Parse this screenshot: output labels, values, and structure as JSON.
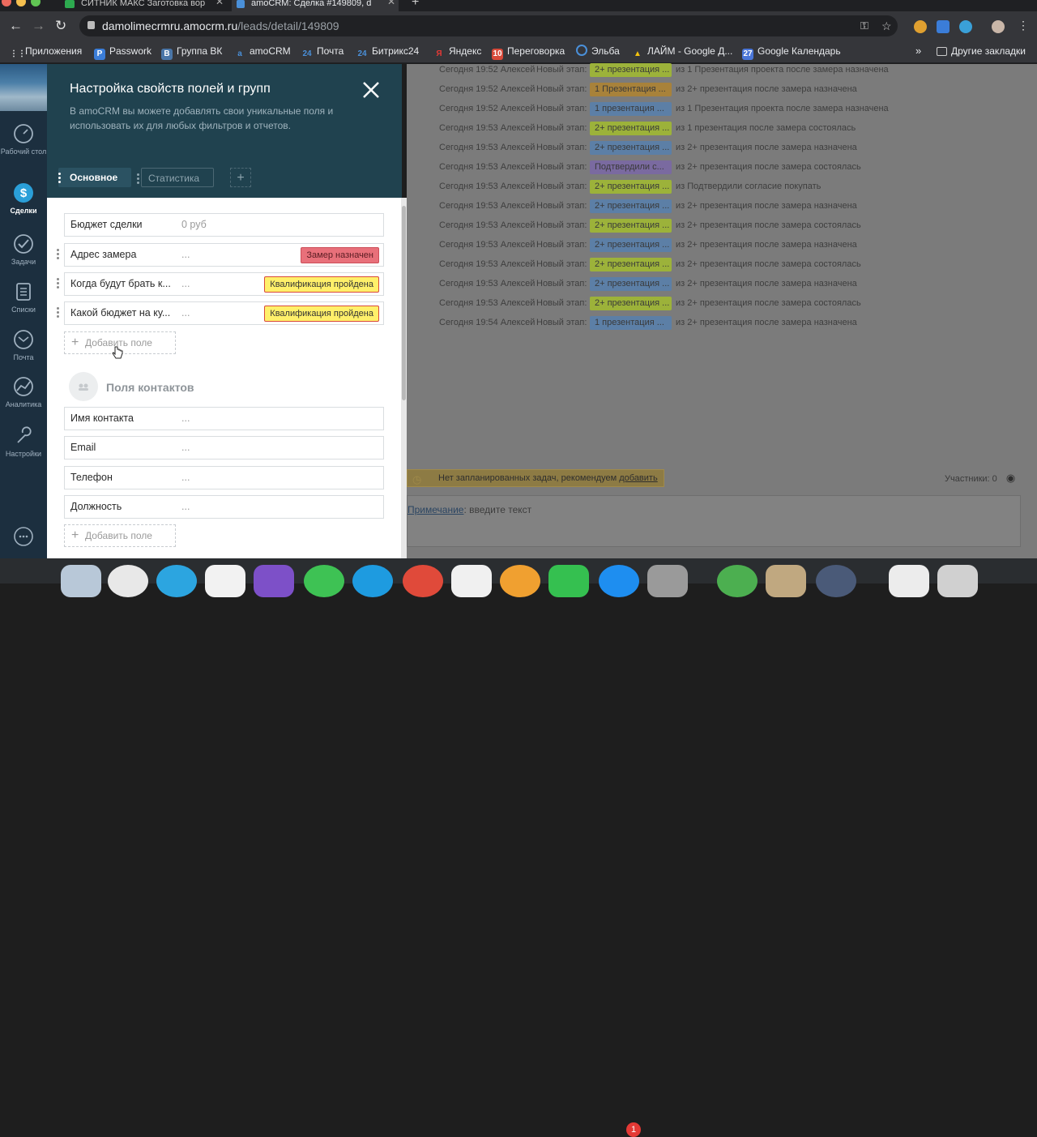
{
  "browser": {
    "tabs": [
      {
        "title": "СИТНИК МАКС Заготовка вор",
        "active": false
      },
      {
        "title": "amoCRM: Сделка #149809, d",
        "active": true
      }
    ],
    "new_tab": "+",
    "url_host": "damolimecrmru.amocrm.ru",
    "url_path": "/leads/detail/149809",
    "bookmarks": [
      "Приложения",
      "Passwork",
      "Группа ВК",
      "amoCRM",
      "Почта",
      "Битрикс24",
      "Яндекс",
      "Переговорка",
      "Эльба",
      "ЛАЙМ - Google Д...",
      "Google Календарь"
    ],
    "bookmarks_more": "»",
    "other_bookmarks": "Другие закладки"
  },
  "sidebar": {
    "items": [
      {
        "label": "Рабочий стол",
        "icon": "speedometer-icon"
      },
      {
        "label": "Сделки",
        "icon": "dollar-icon",
        "active": true
      },
      {
        "label": "Задачи",
        "icon": "check-icon"
      },
      {
        "label": "Списки",
        "icon": "list-icon"
      },
      {
        "label": "Почта",
        "icon": "mail-icon"
      },
      {
        "label": "Аналитика",
        "icon": "analytics-icon"
      },
      {
        "label": "Настройки",
        "icon": "wrench-icon"
      }
    ]
  },
  "panel": {
    "title": "Настройка свойств полей и групп",
    "description": "В amoCRM вы можете добавлять свои уникальные поля и использовать их для любых фильтров и отчетов.",
    "tabs": [
      "Основное",
      "Статистика"
    ],
    "add_tab": "+",
    "main_fields": [
      {
        "name": "Бюджет сделки",
        "value": "0 руб",
        "tag": ""
      },
      {
        "name": "Адрес замера",
        "value": "...",
        "tag": "Замер назначен"
      },
      {
        "name": "Когда будут брать к...",
        "value": "...",
        "tag": "Квалификация пройдена"
      },
      {
        "name": "Какой бюджет на ку...",
        "value": "...",
        "tag": "Квалификация пройдена"
      }
    ],
    "add_field": "Добавить поле",
    "contacts_title": "Поля контактов",
    "contact_fields": [
      {
        "name": "Имя контакта",
        "value": "..."
      },
      {
        "name": "Email",
        "value": "..."
      },
      {
        "name": "Телефон",
        "value": "..."
      },
      {
        "name": "Должность",
        "value": "..."
      }
    ]
  },
  "log": {
    "rows": [
      {
        "when": "Сегодня 19:52 Алексей",
        "action": "Новый этап:",
        "badge": "2+ презентация ...",
        "color": "#9cb23a",
        "from": "из 1 Презентация проекта после замера назначена"
      },
      {
        "when": "Сегодня 19:52 Алексей",
        "action": "Новый этап:",
        "badge": "1 Презентация ...",
        "color": "#a8823a",
        "from": "из 2+ презентация после замера назначена"
      },
      {
        "when": "Сегодня 19:52 Алексей",
        "action": "Новый этап:",
        "badge": "1 презентация ...",
        "color": "#5c7fa6",
        "from": "из 1 Презентация проекта после замера назначена"
      },
      {
        "when": "Сегодня 19:53 Алексей",
        "action": "Новый этап:",
        "badge": "2+ презентация ...",
        "color": "#9cb23a",
        "from": "из 1 презентация после замера состоялась"
      },
      {
        "when": "Сегодня 19:53 Алексей",
        "action": "Новый этап:",
        "badge": "2+ презентация ...",
        "color": "#5c7fa6",
        "from": "из 2+ презентация после замера назначена"
      },
      {
        "when": "Сегодня 19:53 Алексей",
        "action": "Новый этап:",
        "badge": "Подтвердили с...",
        "color": "#7a6aa0",
        "from": "из 2+ презентация после замера состоялась"
      },
      {
        "when": "Сегодня 19:53 Алексей",
        "action": "Новый этап:",
        "badge": "2+ презентация ...",
        "color": "#9cb23a",
        "from": "из Подтвердили согласие покупать"
      },
      {
        "when": "Сегодня 19:53 Алексей",
        "action": "Новый этап:",
        "badge": "2+ презентация ...",
        "color": "#5c7fa6",
        "from": "из 2+ презентация после замера назначена"
      },
      {
        "when": "Сегодня 19:53 Алексей",
        "action": "Новый этап:",
        "badge": "2+ презентация ...",
        "color": "#9cb23a",
        "from": "из 2+ презентация после замера состоялась"
      },
      {
        "when": "Сегодня 19:53 Алексей",
        "action": "Новый этап:",
        "badge": "2+ презентация ...",
        "color": "#5c7fa6",
        "from": "из 2+ презентация после замера назначена"
      },
      {
        "when": "Сегодня 19:53 Алексей",
        "action": "Новый этап:",
        "badge": "2+ презентация ...",
        "color": "#9cb23a",
        "from": "из 2+ презентация после замера состоялась"
      },
      {
        "when": "Сегодня 19:53 Алексей",
        "action": "Новый этап:",
        "badge": "2+ презентация ...",
        "color": "#5c7fa6",
        "from": "из 2+ презентация после замера назначена"
      },
      {
        "when": "Сегодня 19:53 Алексей",
        "action": "Новый этап:",
        "badge": "2+ презентация ...",
        "color": "#9cb23a",
        "from": "из 2+ презентация после замера состоялась"
      },
      {
        "when": "Сегодня 19:54 Алексей",
        "action": "Новый этап:",
        "badge": "1 презентация ...",
        "color": "#5c7fa6",
        "from": "из 2+ презентация после замера назначена"
      }
    ],
    "no_tasks": "Нет запланированных задач, рекомендуем",
    "no_tasks_link": "добавить",
    "members": "Участники: 0",
    "note_label": "Примечание",
    "note_placeholder": ": введите текст"
  },
  "colors": {
    "panel_header": "#20424f",
    "tag_red": "#e8707a",
    "tag_yellow": "#fff06a"
  }
}
